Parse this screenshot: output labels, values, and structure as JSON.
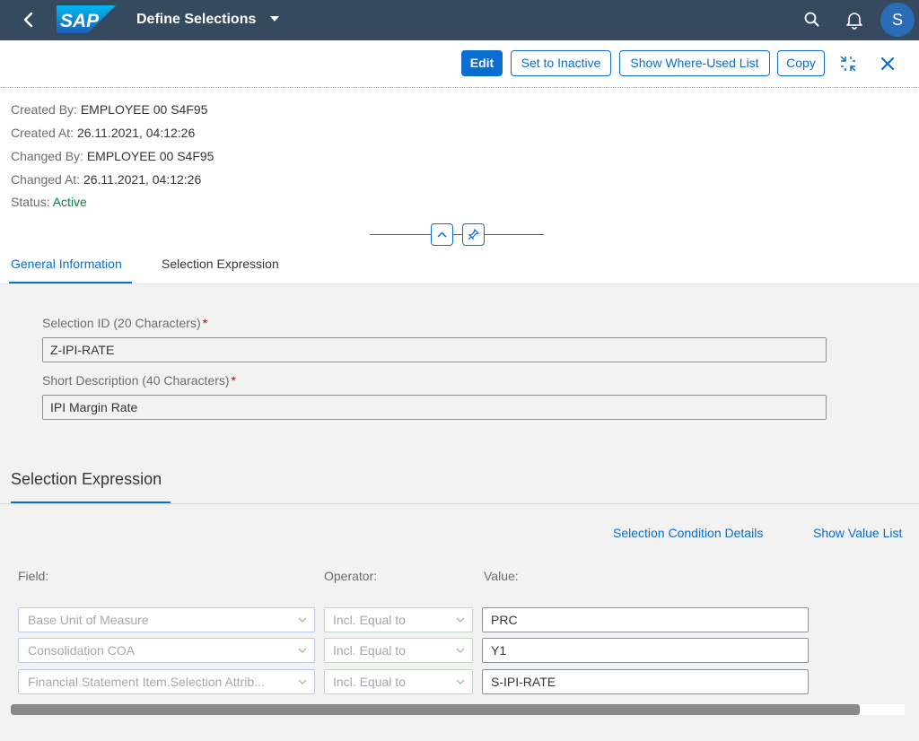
{
  "shell": {
    "logo_text": "SAP",
    "app_title": "Define Selections",
    "avatar_initial": "S",
    "icons": [
      "back-icon",
      "search-icon",
      "bell-icon"
    ],
    "background": "#354a5f"
  },
  "toolbar": {
    "edit_label": "Edit",
    "set_inactive_label": "Set to Inactive",
    "where_used_label": "Show Where-Used List",
    "copy_label": "Copy",
    "icons": [
      "exit-full-screen-icon",
      "close-icon"
    ]
  },
  "header": {
    "created_by_label": "Created By:",
    "created_by_value": "EMPLOYEE 00 S4F95",
    "created_at_label": "Created At:",
    "created_at_value": "26.11.2021, 04:12:26",
    "changed_by_label": "Changed By:",
    "changed_by_value": "EMPLOYEE 00 S4F95",
    "changed_at_label": "Changed At:",
    "changed_at_value": "26.11.2021, 04:12:26",
    "status_label": "Status:",
    "status_value": "Active",
    "status_color": "#107e3e"
  },
  "tabs": [
    {
      "label": "General Information",
      "active": true
    },
    {
      "label": "Selection Expression",
      "active": false
    }
  ],
  "general": {
    "selection_id_label": "Selection ID (20 Characters)",
    "selection_id_value": "Z-IPI-RATE",
    "short_desc_label": "Short Description (40 Characters)",
    "short_desc_value": "IPI Margin Rate",
    "required_marker": "*"
  },
  "selection_expression": {
    "title": "Selection Expression",
    "condition_details_link": "Selection Condition Details",
    "show_value_list_link": "Show Value List",
    "col_field": "Field:",
    "col_operator": "Operator:",
    "col_value": "Value:",
    "rows": [
      {
        "field": "Base Unit of Measure",
        "operator": "Incl. Equal to",
        "value": "PRC"
      },
      {
        "field": "Consolidation COA",
        "operator": "Incl. Equal to",
        "value": "Y1"
      },
      {
        "field": "Financial Statement Item.Selection Attrib...",
        "operator": "Incl. Equal to",
        "value": "S-IPI-RATE"
      }
    ]
  },
  "accent_color": "#0a6ed1"
}
